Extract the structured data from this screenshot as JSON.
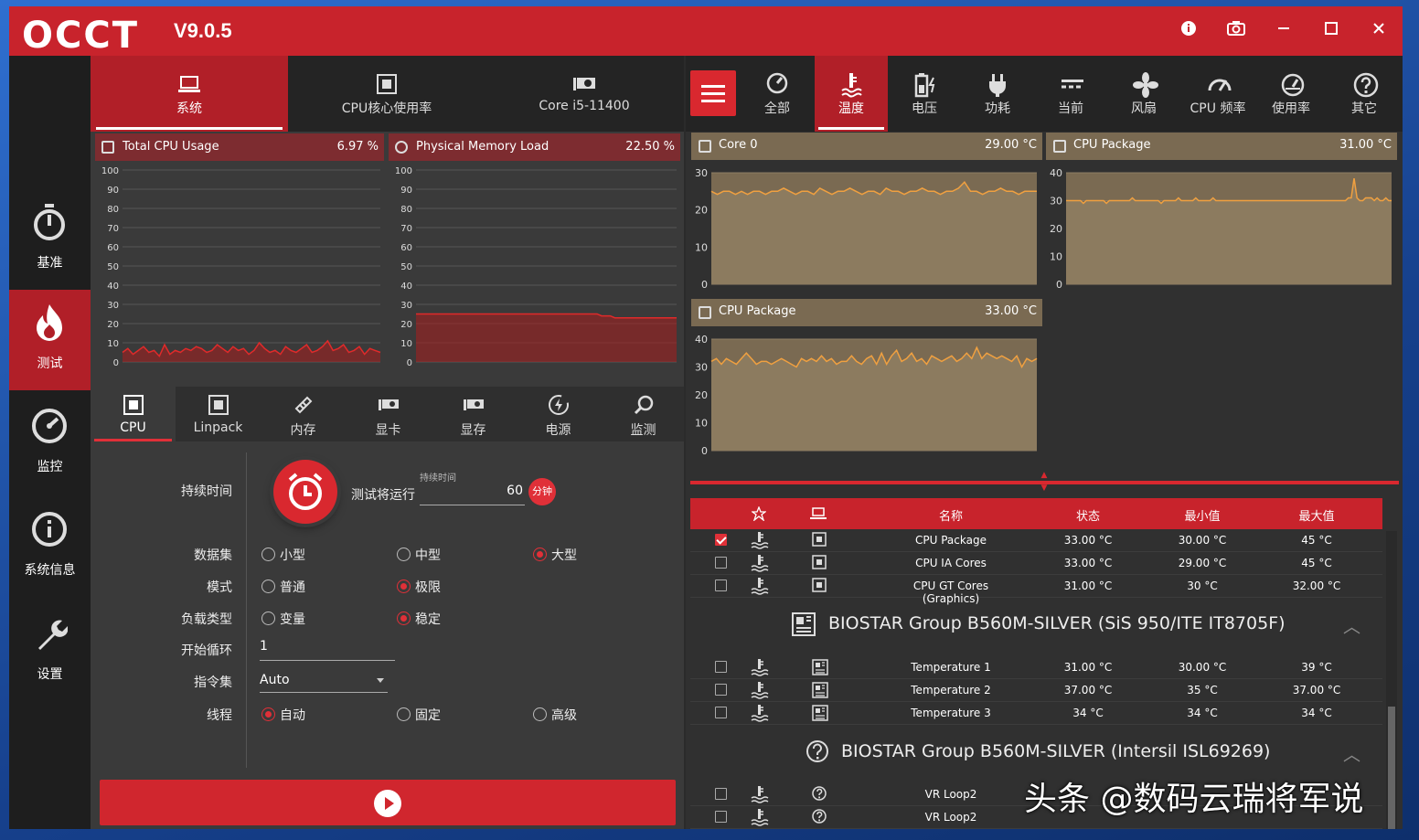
{
  "app": {
    "logo": "OCCT",
    "version": "V9.0.5"
  },
  "sidebar": {
    "items": [
      {
        "label": "基准",
        "icon": "stopwatch-icon"
      },
      {
        "label": "测试",
        "icon": "flame-icon",
        "active": true
      },
      {
        "label": "监控",
        "icon": "gauge-icon"
      },
      {
        "label": "系统信息",
        "icon": "info-icon"
      },
      {
        "label": "设置",
        "icon": "wrench-icon"
      }
    ]
  },
  "top_tabs": [
    {
      "label": "系统",
      "icon": "laptop-icon",
      "active": true
    },
    {
      "label": "CPU核心使用率",
      "icon": "cpu-icon"
    },
    {
      "label": "Core i5-11400",
      "icon": "gpu-icon"
    }
  ],
  "graphs": [
    {
      "name": "Total CPU Usage",
      "value": "6.97 %"
    },
    {
      "name": "Physical Memory Load",
      "value": "22.50 %"
    }
  ],
  "y_ticks_100": [
    "100",
    "90",
    "80",
    "70",
    "60",
    "50",
    "40",
    "30",
    "20",
    "10",
    "0"
  ],
  "sub_tabs": [
    {
      "label": "CPU",
      "icon": "cpu-icon",
      "active": true
    },
    {
      "label": "Linpack",
      "icon": "cpu-icon"
    },
    {
      "label": "内存",
      "icon": "memory-icon"
    },
    {
      "label": "显卡",
      "icon": "gpu-icon"
    },
    {
      "label": "显存",
      "icon": "vram-icon"
    },
    {
      "label": "电源",
      "icon": "power-icon"
    },
    {
      "label": "监测",
      "icon": "search-icon"
    }
  ],
  "form": {
    "duration_label": "持续时间",
    "run_label": "测试将运行",
    "duration_caption": "持续时间",
    "duration_value": "60",
    "duration_unit": "分钟",
    "dataset_label": "数据集",
    "dataset_options": [
      "小型",
      "中型",
      "大型"
    ],
    "mode_label": "模式",
    "mode_options": [
      "普通",
      "极限"
    ],
    "load_label": "负载类型",
    "load_options": [
      "变量",
      "稳定"
    ],
    "loop_label": "开始循环",
    "loop_value": "1",
    "instr_label": "指令集",
    "instr_value": "Auto",
    "thread_label": "线程",
    "thread_options": [
      "自动",
      "固定",
      "高级"
    ]
  },
  "sensor_tabs": [
    {
      "label": "全部",
      "icon": "all-icon"
    },
    {
      "label": "温度",
      "icon": "thermometer-icon",
      "active": true
    },
    {
      "label": "电压",
      "icon": "battery-icon"
    },
    {
      "label": "功耗",
      "icon": "plug-icon"
    },
    {
      "label": "当前",
      "icon": "current-icon"
    },
    {
      "label": "风扇",
      "icon": "fan-icon"
    },
    {
      "label": "CPU 频率",
      "icon": "speedometer-icon"
    },
    {
      "label": "使用率",
      "icon": "usage-gauge-icon"
    },
    {
      "label": "其它",
      "icon": "question-icon"
    }
  ],
  "temp_graphs": [
    {
      "name": "Core 0",
      "value": "29.00 °C"
    },
    {
      "name": "CPU Package",
      "value": "31.00 °C"
    },
    {
      "name": "CPU Package",
      "value": "33.00 °C"
    }
  ],
  "ticks_30": [
    "30",
    "20",
    "10",
    "0"
  ],
  "ticks_40": [
    "40",
    "30",
    "20",
    "10",
    "0"
  ],
  "table": {
    "headers": [
      "名称",
      "状态",
      "最小值",
      "最大值"
    ],
    "rows": [
      {
        "name": "CPU Package",
        "status": "33.00 °C",
        "min": "30.00 °C",
        "max": "45 °C",
        "checked": true
      },
      {
        "name": "CPU IA Cores",
        "status": "33.00 °C",
        "min": "29.00 °C",
        "max": "45 °C"
      },
      {
        "name": "CPU GT Cores (Graphics)",
        "status": "31.00 °C",
        "min": "30 °C",
        "max": "32.00 °C"
      }
    ],
    "group1": "BIOSTAR Group B560M-SILVER (SiS 950/ITE IT8705F)",
    "group1_rows": [
      {
        "name": "Temperature 1",
        "status": "31.00 °C",
        "min": "30.00 °C",
        "max": "39 °C"
      },
      {
        "name": "Temperature 2",
        "status": "37.00 °C",
        "min": "35 °C",
        "max": "37.00 °C"
      },
      {
        "name": "Temperature 3",
        "status": "34 °C",
        "min": "34 °C",
        "max": "34 °C"
      }
    ],
    "group2": "BIOSTAR Group B560M-SILVER (Intersil ISL69269)",
    "group2_rows": [
      {
        "name": "VR Loop2"
      },
      {
        "name": "VR Loop2"
      }
    ]
  },
  "watermark": "头条 @数码云瑞将军说"
}
